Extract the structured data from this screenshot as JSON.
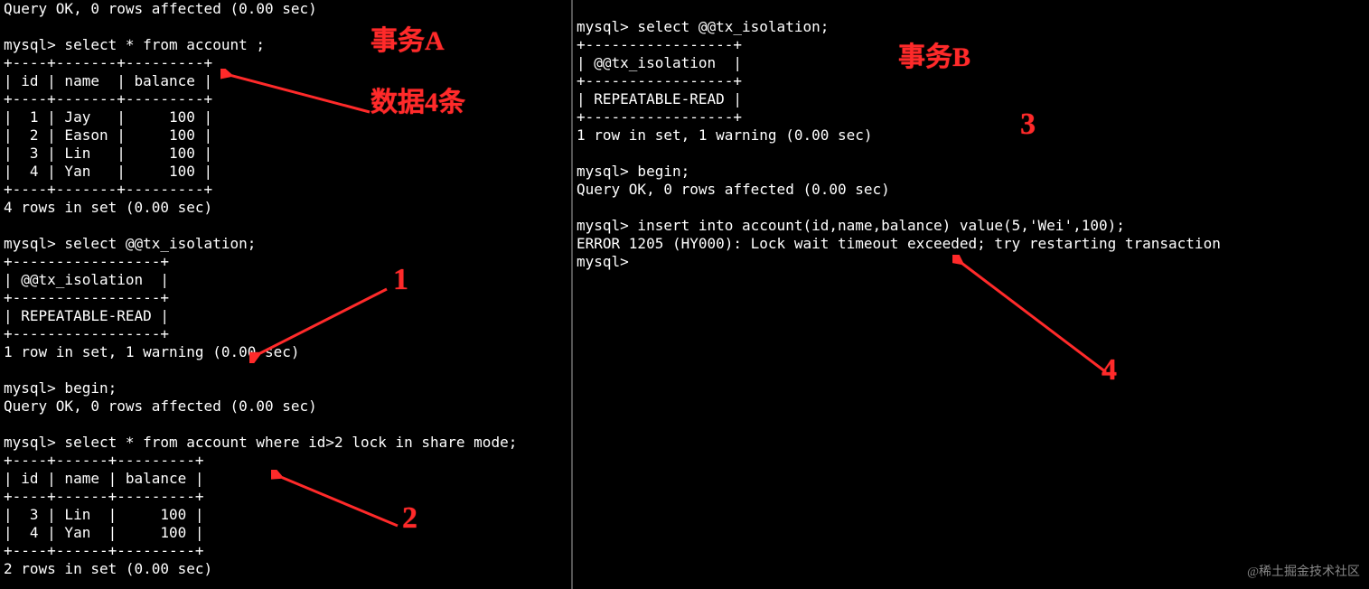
{
  "left": {
    "lines": [
      "Query OK, 0 rows affected (0.00 sec)",
      "",
      "mysql> select * from account ;",
      "+----+-------+---------+",
      "| id | name  | balance |",
      "+----+-------+---------+",
      "|  1 | Jay   |     100 |",
      "|  2 | Eason |     100 |",
      "|  3 | Lin   |     100 |",
      "|  4 | Yan   |     100 |",
      "+----+-------+---------+",
      "4 rows in set (0.00 sec)",
      "",
      "mysql> select @@tx_isolation;",
      "+-----------------+",
      "| @@tx_isolation  |",
      "+-----------------+",
      "| REPEATABLE-READ |",
      "+-----------------+",
      "1 row in set, 1 warning (0.00 sec)",
      "",
      "mysql> begin;",
      "Query OK, 0 rows affected (0.00 sec)",
      "",
      "mysql> select * from account where id>2 lock in share mode;",
      "+----+------+---------+",
      "| id | name | balance |",
      "+----+------+---------+",
      "|  3 | Lin  |     100 |",
      "|  4 | Yan  |     100 |",
      "+----+------+---------+",
      "2 rows in set (0.00 sec)"
    ]
  },
  "right": {
    "lines": [
      "",
      "mysql> select @@tx_isolation;",
      "+-----------------+",
      "| @@tx_isolation  |",
      "+-----------------+",
      "| REPEATABLE-READ |",
      "+-----------------+",
      "1 row in set, 1 warning (0.00 sec)",
      "",
      "mysql> begin;",
      "Query OK, 0 rows affected (0.00 sec)",
      "",
      "mysql> insert into account(id,name,balance) value(5,'Wei',100);",
      "ERROR 1205 (HY000): Lock wait timeout exceeded; try restarting transaction",
      "mysql>"
    ]
  },
  "annotations": {
    "txA": "事务A",
    "data4": "数据4条",
    "txB": "事务B",
    "n1": "1",
    "n2": "2",
    "n3": "3",
    "n4": "4"
  },
  "watermark": "@稀土掘金技术社区"
}
